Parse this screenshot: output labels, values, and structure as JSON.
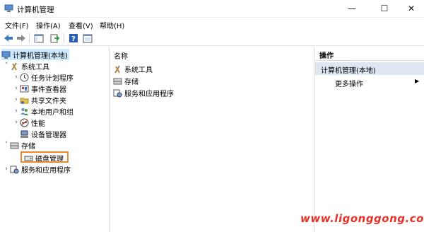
{
  "window": {
    "title": "计算机管理",
    "minimize_glyph": "—",
    "maximize_glyph": "☐",
    "close_glyph": "✕"
  },
  "menu": [
    "文件(F)",
    "操作(A)",
    "查看(V)",
    "帮助(H)"
  ],
  "toolbar": {
    "icons": [
      "back-arrow-icon",
      "forward-arrow-icon",
      "show-hide-tree-icon",
      "export-list-icon",
      "help-icon",
      "properties-icon"
    ]
  },
  "tree": {
    "root": "计算机管理(本地)",
    "system_tools": "系统工具",
    "system_children": [
      "任务计划程序",
      "事件查看器",
      "共享文件夹",
      "本地用户和组",
      "性能",
      "设备管理器"
    ],
    "storage": "存储",
    "disk_management": "磁盘管理",
    "services": "服务和应用程序"
  },
  "middle": {
    "column_header": "名称",
    "items": [
      "系统工具",
      "存储",
      "服务和应用程序"
    ]
  },
  "actions": {
    "title": "操作",
    "section": "计算机管理(本地)",
    "more": "更多操作"
  },
  "watermark": "www.ligonggong.com",
  "colors": {
    "selection": "#cce8ff",
    "highlight_box": "#f0892c",
    "actions_section_bg": "#dde6f1",
    "watermark": "#e3342a"
  }
}
